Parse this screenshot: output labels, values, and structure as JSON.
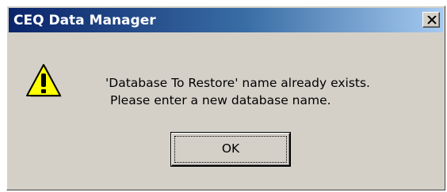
{
  "window": {
    "title": "CEQ Data Manager"
  },
  "dialog": {
    "icon": "warning-icon",
    "message_line1": "'Database To Restore' name already exists.",
    "message_line2": "Please enter a new database name.",
    "ok_label": "OK"
  },
  "colors": {
    "dialog_bg": "#d4d0c8",
    "titlebar_start": "#0a246a",
    "titlebar_end": "#a6caf0",
    "warning_yellow": "#ffff00"
  }
}
